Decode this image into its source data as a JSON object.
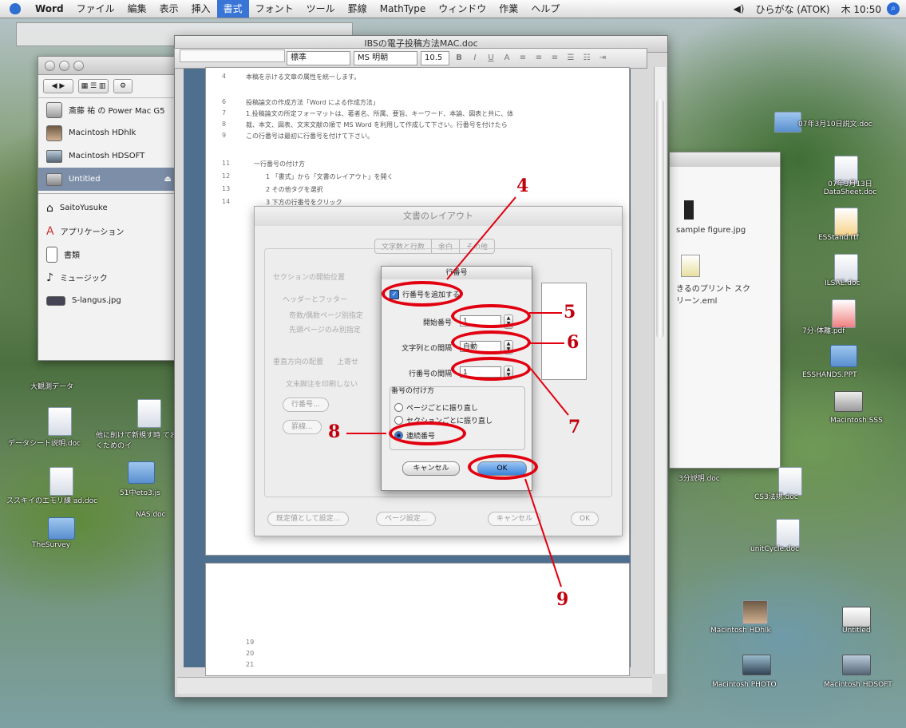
{
  "menubar": {
    "items": [
      "Word",
      "ファイル",
      "編集",
      "表示",
      "挿入",
      "書式",
      "フォント",
      "ツール",
      "罫線",
      "MathType",
      "ウィンドウ",
      "作業",
      "ヘルプ"
    ],
    "selected": "書式",
    "input_method": "ひらがな (ATOK)",
    "clock": "木 10:50"
  },
  "finder": {
    "items": [
      {
        "label": "斎藤 祐 の Power Mac G5"
      },
      {
        "label": "Macintosh HDhlk"
      },
      {
        "label": "Macintosh HDSOFT"
      },
      {
        "label": "Untitled"
      }
    ],
    "places": [
      {
        "label": "SaitoYusuke"
      },
      {
        "label": "アプリケーション"
      },
      {
        "label": "書類"
      },
      {
        "label": "ミュージック"
      },
      {
        "label": "S-langus.jpg"
      }
    ]
  },
  "doc_window": {
    "title": "IBSの電子投稿方法MAC.doc",
    "style_select": "標準",
    "font_select": "MS 明朝",
    "size_select": "10.5"
  },
  "page_lines": [
    {
      "no": "4",
      "text": "本稿を示ける文章の属性を統一します。"
    },
    {
      "no": "6",
      "text": "投稿論文の作成方法「Word による作成方法」"
    },
    {
      "no": "7",
      "text": "1.投稿論文の所定フォーマットは、著者名、所属、要旨、キーワード、本論、図表と共に、体"
    },
    {
      "no": "8",
      "text": "裁、本文、図表、文末文献の順で MS Word を利用して作成して下さい。行番号を付けたら"
    },
    {
      "no": "9",
      "text": "この行番号は最初に行番号を付けて下さい。"
    },
    {
      "no": "11",
      "text": "一行番号の付け方"
    },
    {
      "no": "12",
      "text": "1 「書式」から「文書のレイアウト」を開く"
    },
    {
      "no": "13",
      "text": "2 その他タグを選択"
    },
    {
      "no": "14",
      "text": "3 下方の行番号をクリック"
    }
  ],
  "page2_lines": [
    "19",
    "20",
    "21"
  ],
  "layout_dialog": {
    "title": "文書のレイアウト",
    "tabs": [
      "文字数と行数",
      "余白",
      "その他"
    ],
    "section_label": "セクションの開始位置",
    "header_footer_label": "ヘッダーとフッター",
    "odd_even": "奇数/偶数ページ別指定",
    "first_page": "先頭ページのみ別指定",
    "vertical_label": "垂直方向の配置",
    "vertical_value": "上寄せ",
    "suppress": "文末脚注を印刷しない",
    "line_numbers_btn": "行番号...",
    "borders_btn": "罫線...",
    "default_btn": "既定値として設定...",
    "page_setup_btn": "ページ設定...",
    "cancel_btn": "キャンセル",
    "ok_btn": "OK"
  },
  "line_number_dialog": {
    "title": "行番号",
    "add_checkbox": "行番号を追加する",
    "start_label": "開始番号",
    "start_value": "1",
    "distance_label": "文字列との間隔",
    "distance_value": "自動",
    "interval_label": "行番号の間隔",
    "interval_value": "1",
    "numbering_label": "番号の付け方",
    "opt_page": "ページごとに振り直し",
    "opt_section": "セクションごとに振り直し",
    "opt_continuous": "連続番号",
    "cancel_btn": "キャンセル",
    "ok_btn": "OK"
  },
  "annotations": [
    "4",
    "5",
    "6",
    "7",
    "8",
    "9"
  ],
  "desktop_icons": [
    "大観測データ",
    "データシート説明.doc",
    "他に削けて新規す時 ておくためのイ",
    "ススキイのエモリ練 ad.doc",
    "51中eto3.js",
    "NAS.doc",
    "TheSurvey",
    "07年3月13日 DataSheet.doc",
    "ESStand.rtf",
    "ILSAE.doc",
    "7分-体離.pdf",
    "ESSHANDS.PPT",
    "Macintosh SSS",
    "Macintosh HDhlk",
    "Untitled",
    "Macintosh PHOTO",
    "Macintosh HDSOFT",
    "3分説明.doc",
    "CS3法規.doc",
    "unitCycle.doc",
    "07年3月10日説文.doc"
  ],
  "right_window": {
    "items": [
      "sample figure.jpg",
      "きるのプリント スクリーン.eml"
    ]
  }
}
